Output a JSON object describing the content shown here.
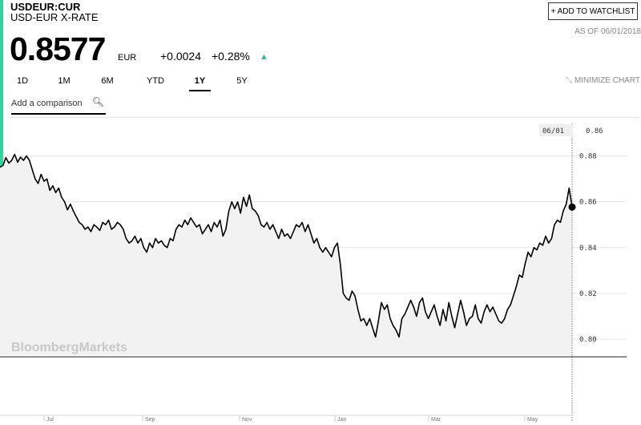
{
  "header": {
    "ticker": "USDEUR:CUR",
    "name": "USD-EUR X-RATE",
    "price": "0.8577",
    "currency": "EUR",
    "change": "+0.0024",
    "change_pct": "+0.28%",
    "up_arrow": "▲",
    "watchlist_label": "+ ADD TO WATCHLIST",
    "as_of": "AS OF 06/01/2018"
  },
  "tabs": [
    {
      "label": "1D",
      "active": false
    },
    {
      "label": "1M",
      "active": false
    },
    {
      "label": "6M",
      "active": false
    },
    {
      "label": "YTD",
      "active": false
    },
    {
      "label": "1Y",
      "active": true
    },
    {
      "label": "5Y",
      "active": false
    }
  ],
  "minimize_label": "MINIMIZE CHART",
  "comparison": {
    "placeholder": "Add a comparison",
    "icon": "search-icon"
  },
  "colors": {
    "accent": "#2fd49a",
    "up": "#2fc28f",
    "area": "#f2f2f2",
    "line": "#000000"
  },
  "chart_data": {
    "type": "area",
    "watermark": "BloombergMarkets",
    "tooltip": {
      "date": "06/01",
      "value": "0.86"
    },
    "y_ticks": [
      "0.88",
      "0.86",
      "0.84",
      "0.82",
      "0.80"
    ],
    "ylim": [
      0.793,
      0.897
    ],
    "x_ticks": [
      "Jul",
      "Sep",
      "Nov",
      "Jan",
      "Mar",
      "May"
    ],
    "grid": "horizontal",
    "last_value": 0.8577,
    "series": [
      {
        "values": [
          0.8751,
          0.8759,
          0.8793,
          0.8769,
          0.8781,
          0.8807,
          0.8773,
          0.8795,
          0.8781,
          0.88,
          0.8782,
          0.874,
          0.87,
          0.868,
          0.872,
          0.869,
          0.87,
          0.865,
          0.867,
          0.864,
          0.866,
          0.862,
          0.86,
          0.8565,
          0.859,
          0.856,
          0.8535,
          0.851,
          0.85,
          0.848,
          0.849,
          0.847,
          0.85,
          0.849,
          0.8475,
          0.851,
          0.85,
          0.852,
          0.848,
          0.849,
          0.851,
          0.85,
          0.848,
          0.844,
          0.842,
          0.843,
          0.845,
          0.842,
          0.844,
          0.84,
          0.838,
          0.842,
          0.84,
          0.844,
          0.842,
          0.843,
          0.841,
          0.84,
          0.844,
          0.843,
          0.848,
          0.85,
          0.849,
          0.852,
          0.85,
          0.853,
          0.851,
          0.849,
          0.85,
          0.846,
          0.848,
          0.85,
          0.847,
          0.851,
          0.849,
          0.852,
          0.845,
          0.848,
          0.856,
          0.86,
          0.857,
          0.86,
          0.855,
          0.862,
          0.858,
          0.863,
          0.857,
          0.856,
          0.854,
          0.85,
          0.849,
          0.851,
          0.848,
          0.85,
          0.847,
          0.844,
          0.848,
          0.845,
          0.846,
          0.844,
          0.847,
          0.85,
          0.849,
          0.851,
          0.847,
          0.85,
          0.846,
          0.842,
          0.844,
          0.84,
          0.838,
          0.84,
          0.838,
          0.836,
          0.84,
          0.842,
          0.833,
          0.82,
          0.818,
          0.817,
          0.821,
          0.819,
          0.813,
          0.808,
          0.809,
          0.806,
          0.809,
          0.805,
          0.801,
          0.808,
          0.816,
          0.813,
          0.815,
          0.809,
          0.806,
          0.804,
          0.801,
          0.809,
          0.811,
          0.814,
          0.817,
          0.814,
          0.81,
          0.816,
          0.818,
          0.812,
          0.809,
          0.812,
          0.815,
          0.81,
          0.806,
          0.813,
          0.808,
          0.816,
          0.81,
          0.805,
          0.811,
          0.817,
          0.812,
          0.806,
          0.809,
          0.81,
          0.815,
          0.809,
          0.807,
          0.812,
          0.815,
          0.812,
          0.814,
          0.811,
          0.808,
          0.807,
          0.809,
          0.813,
          0.815,
          0.819,
          0.823,
          0.828,
          0.827,
          0.833,
          0.838,
          0.836,
          0.84,
          0.839,
          0.842,
          0.841,
          0.845,
          0.842,
          0.844,
          0.85,
          0.852,
          0.851,
          0.856,
          0.859,
          0.866,
          0.8577
        ]
      }
    ]
  }
}
